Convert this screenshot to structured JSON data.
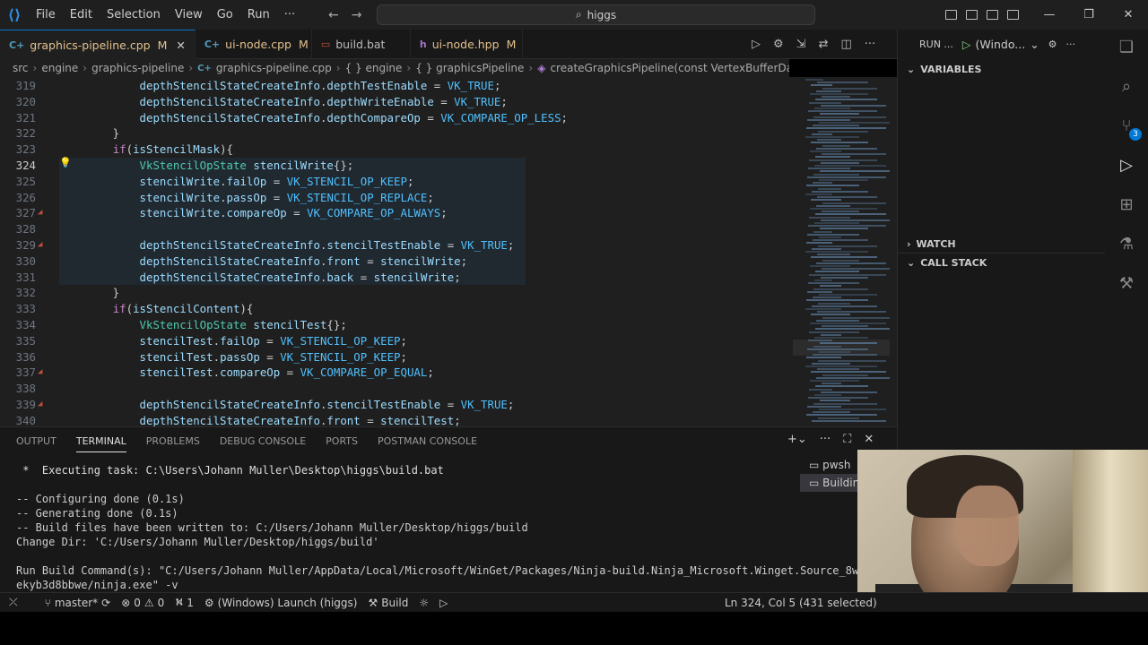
{
  "titlebar": {
    "menu": [
      "File",
      "Edit",
      "Selection",
      "View",
      "Go",
      "Run",
      "···"
    ],
    "search": "higgs"
  },
  "tabs": [
    {
      "label": "graphics-pipeline.cpp",
      "badge": "M",
      "icon": "C++",
      "active": true
    },
    {
      "label": "ui-node.cpp",
      "badge": "M",
      "icon": "C++",
      "active": false
    },
    {
      "label": "build.bat",
      "badge": "",
      "icon": "bat",
      "active": false
    },
    {
      "label": "ui-node.hpp",
      "badge": "M",
      "icon": "H",
      "active": false
    }
  ],
  "breadcrumb": [
    "src",
    "engine",
    "graphics-pipeline",
    "graphics-pipeline.cpp",
    "{ } engine",
    "{ } graphicsPipeline",
    "createGraphicsPipeline(const VertexBufferDataType)"
  ],
  "code": {
    "current_line": "324",
    "lines": [
      {
        "n": "319",
        "t": "            depthStencilStateCreateInfo.depthTestEnable = VK_TRUE;"
      },
      {
        "n": "320",
        "t": "            depthStencilStateCreateInfo.depthWriteEnable = VK_TRUE;"
      },
      {
        "n": "321",
        "t": "            depthStencilStateCreateInfo.depthCompareOp = VK_COMPARE_OP_LESS;"
      },
      {
        "n": "322",
        "t": "        }"
      },
      {
        "n": "323",
        "t": "        if(isStencilMask){"
      },
      {
        "n": "324",
        "t": "            VkStencilOpState stencilWrite{};"
      },
      {
        "n": "325",
        "t": "            stencilWrite.failOp = VK_STENCIL_OP_KEEP;"
      },
      {
        "n": "326",
        "t": "            stencilWrite.passOp = VK_STENCIL_OP_REPLACE;"
      },
      {
        "n": "327",
        "t": "            stencilWrite.compareOp = VK_COMPARE_OP_ALWAYS;"
      },
      {
        "n": "328",
        "t": ""
      },
      {
        "n": "329",
        "t": "            depthStencilStateCreateInfo.stencilTestEnable = VK_TRUE;"
      },
      {
        "n": "330",
        "t": "            depthStencilStateCreateInfo.front = stencilWrite;"
      },
      {
        "n": "331",
        "t": "            depthStencilStateCreateInfo.back = stencilWrite;"
      },
      {
        "n": "332",
        "t": "        }"
      },
      {
        "n": "333",
        "t": "        if(isStencilContent){"
      },
      {
        "n": "334",
        "t": "            VkStencilOpState stencilTest{};"
      },
      {
        "n": "335",
        "t": "            stencilTest.failOp = VK_STENCIL_OP_KEEP;"
      },
      {
        "n": "336",
        "t": "            stencilTest.passOp = VK_STENCIL_OP_KEEP;"
      },
      {
        "n": "337",
        "t": "            stencilTest.compareOp = VK_COMPARE_OP_EQUAL;"
      },
      {
        "n": "338",
        "t": ""
      },
      {
        "n": "339",
        "t": "            depthStencilStateCreateInfo.stencilTestEnable = VK_TRUE;"
      },
      {
        "n": "340",
        "t": "            depthStencilStateCreateInfo.front = stencilTest;"
      }
    ]
  },
  "debug": {
    "run_label": "RUN ...",
    "config": "(Windo...",
    "sections": [
      "VARIABLES",
      "WATCH",
      "CALL STACK"
    ]
  },
  "panel": {
    "tabs": [
      "OUTPUT",
      "TERMINAL",
      "PROBLEMS",
      "DEBUG CONSOLE",
      "PORTS",
      "POSTMAN CONSOLE"
    ],
    "terminal_lines": [
      " *  Executing task: C:\\Users\\Johann Muller\\Desktop\\higgs\\build.bat",
      "",
      "-- Configuring done (0.1s)",
      "-- Generating done (0.1s)",
      "-- Build files have been written to: C:/Users/Johann Muller/Desktop/higgs/build",
      "Change Dir: 'C:/Users/Johann Muller/Desktop/higgs/build'",
      "",
      "Run Build Command(s): \"C:/Users/Johann Muller/AppData/Local/Microsoft/WinGet/Packages/Ninja-build.Ninja_Microsoft.Winget.Source_8w",
      "ekyb3d8bbwe/ninja.exe\" -v"
    ],
    "terminals": [
      "pwsh",
      "Buildin"
    ]
  },
  "status": {
    "branch": "master*",
    "errors": "0",
    "warnings": "0",
    "ports": "1",
    "launch": "(Windows) Launch (higgs)",
    "build": "Build",
    "position": "Ln 324, Col 5 (431 selected)"
  }
}
